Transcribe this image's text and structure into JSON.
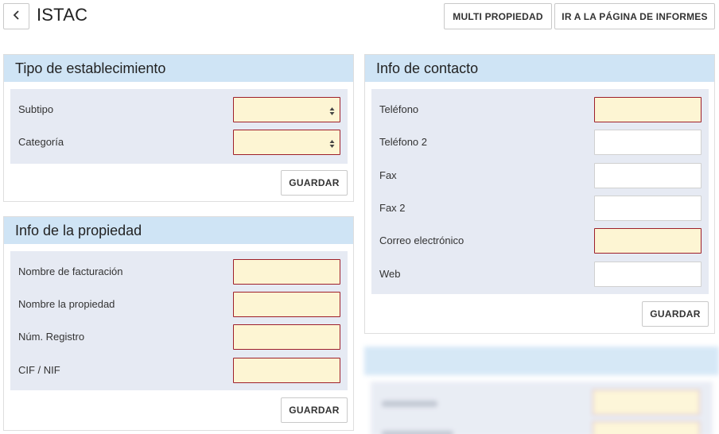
{
  "header": {
    "title": "ISTAC",
    "back_icon": "chevron-left-icon",
    "buttons": {
      "multi": "MULTI PROPIEDAD",
      "informes": "IR A LA PÁGINA DE INFORMES"
    }
  },
  "tipo": {
    "title": "Tipo de establecimiento",
    "fields": [
      {
        "label": "Subtipo",
        "value": ""
      },
      {
        "label": "Categoría",
        "value": ""
      }
    ],
    "save": "GUARDAR"
  },
  "propiedad": {
    "title": "Info de la propiedad",
    "fields": [
      {
        "label": "Nombre de facturación",
        "value": ""
      },
      {
        "label": "Nombre la propiedad",
        "value": ""
      },
      {
        "label": "Núm. Registro",
        "value": ""
      },
      {
        "label": "CIF / NIF",
        "value": ""
      }
    ],
    "save": "GUARDAR"
  },
  "contacto": {
    "title": "Info de contacto",
    "fields": [
      {
        "label": "Teléfono",
        "value": ""
      },
      {
        "label": "Teléfono 2",
        "value": ""
      },
      {
        "label": "Fax",
        "value": ""
      },
      {
        "label": "Fax 2",
        "value": ""
      },
      {
        "label": "Correo electrónico",
        "value": ""
      },
      {
        "label": "Web",
        "value": ""
      }
    ],
    "save": "GUARDAR"
  },
  "colors": {
    "panel_header": "#cfe4f5",
    "panel_body": "#e6eaf3",
    "required_fill": "#fdf5d3",
    "required_border": "#9e1f2a"
  }
}
